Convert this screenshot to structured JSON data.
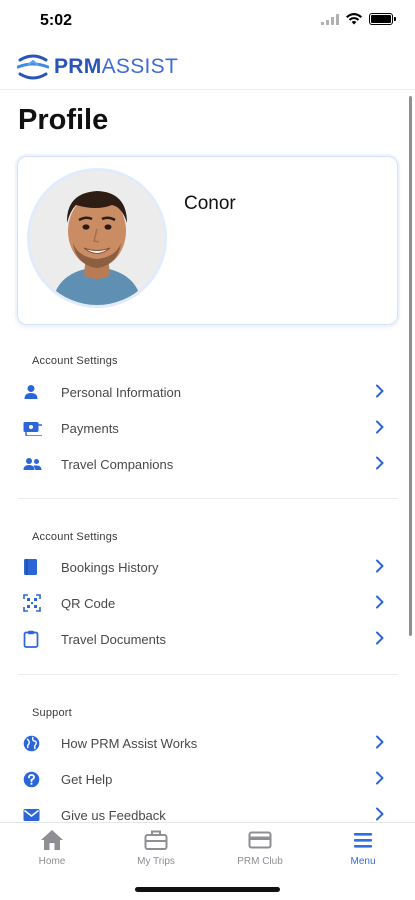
{
  "status_bar": {
    "time": "5:02"
  },
  "brand": {
    "name_bold": "PRM",
    "name_light": "ASSIST",
    "color": "#2a53b8"
  },
  "page": {
    "title": "Profile"
  },
  "profile": {
    "name": "Conor"
  },
  "sections": [
    {
      "label": "Account Settings",
      "items": [
        {
          "label": "Personal Information",
          "icon": "person-icon"
        },
        {
          "label": "Payments",
          "icon": "payments-icon"
        },
        {
          "label": "Travel Companions",
          "icon": "companions-icon"
        }
      ]
    },
    {
      "label": "Account Settings",
      "items": [
        {
          "label": "Bookings History",
          "icon": "book-icon"
        },
        {
          "label": "QR Code",
          "icon": "qr-code-icon"
        },
        {
          "label": "Travel Documents",
          "icon": "clipboard-icon"
        }
      ]
    },
    {
      "label": "Support",
      "items": [
        {
          "label": "How PRM Assist Works",
          "icon": "globe-icon"
        },
        {
          "label": "Get Help",
          "icon": "help-icon"
        },
        {
          "label": "Give us Feedback",
          "icon": "mail-icon"
        }
      ]
    }
  ],
  "tabs": [
    {
      "label": "Home",
      "icon": "home-icon",
      "active": false
    },
    {
      "label": "My Trips",
      "icon": "briefcase-icon",
      "active": false
    },
    {
      "label": "PRM Club",
      "icon": "card-icon",
      "active": false
    },
    {
      "label": "Menu",
      "icon": "menu-icon",
      "active": true
    }
  ],
  "colors": {
    "accent": "#2f6fe0",
    "icon_blue": "#2b66d9",
    "inactive": "#8e8e93"
  }
}
